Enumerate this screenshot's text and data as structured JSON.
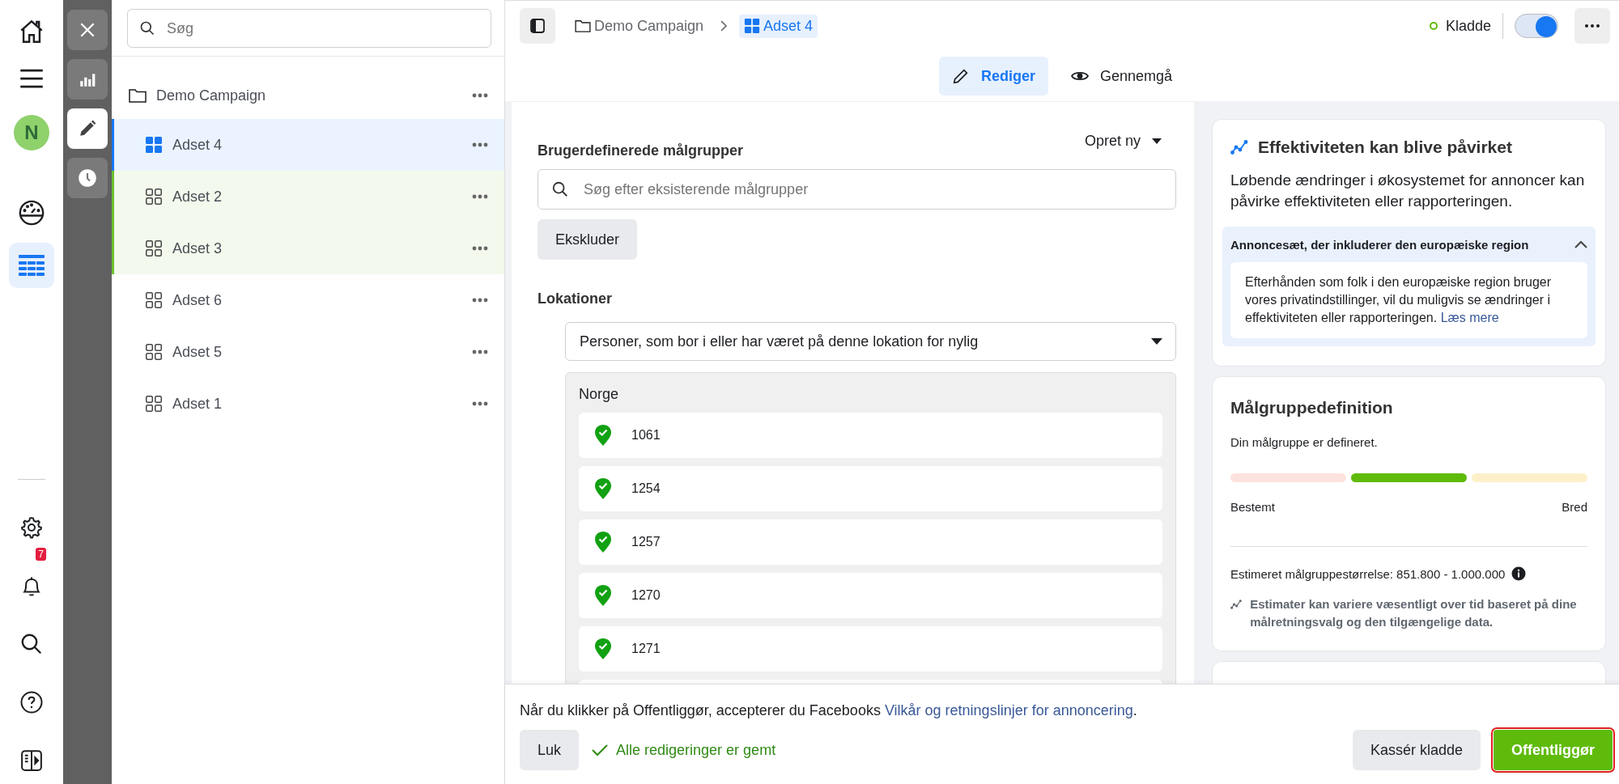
{
  "nav_rail": {
    "top": [
      {
        "kind": "home",
        "selected": false
      },
      {
        "kind": "menu",
        "selected": false
      },
      {
        "kind": "avatar",
        "label": "N",
        "selected": false
      },
      {
        "kind": "gauge",
        "selected": false
      },
      {
        "kind": "table",
        "selected": true
      }
    ],
    "bottom": [
      {
        "kind": "settings"
      },
      {
        "kind": "bell",
        "badge": "7"
      },
      {
        "kind": "search"
      },
      {
        "kind": "help"
      },
      {
        "kind": "panel"
      }
    ]
  },
  "tool_rail": [
    {
      "kind": "close",
      "selected": false
    },
    {
      "kind": "chart",
      "selected": false
    },
    {
      "kind": "edit",
      "selected": true
    },
    {
      "kind": "history",
      "selected": false
    }
  ],
  "tree": {
    "search": {
      "placeholder": "Søg"
    },
    "campaign": {
      "label": "Demo Campaign",
      "children": [
        {
          "label": "Adset 4",
          "selected": true,
          "highlighted": false
        },
        {
          "label": "Adset 2",
          "selected": false,
          "highlighted": true
        },
        {
          "label": "Adset 3",
          "selected": false,
          "highlighted": true
        },
        {
          "label": "Adset 6",
          "selected": false,
          "highlighted": false
        },
        {
          "label": "Adset 5",
          "selected": false,
          "highlighted": false
        },
        {
          "label": "Adset 1",
          "selected": false,
          "highlighted": false
        }
      ]
    }
  },
  "header": {
    "breadcrumbs": [
      {
        "kind": "folder",
        "label": "Demo Campaign",
        "selected": false
      },
      {
        "kind": "adset",
        "label": "Adset 4",
        "selected": true
      }
    ],
    "status": {
      "label": "Kladde"
    },
    "toggle": {
      "on": true
    }
  },
  "mode_tabs": [
    {
      "kind": "edit",
      "label": "Rediger",
      "selected": true
    },
    {
      "kind": "review",
      "label": "Gennemgå",
      "selected": false
    }
  ],
  "audiences": {
    "title": "Brugerdefinerede målgrupper",
    "create_menu": "Opret ny",
    "search": {
      "placeholder": "Søg efter eksisterende målgrupper"
    },
    "exclude_button": "Ekskluder"
  },
  "locations": {
    "title": "Lokationer",
    "dropdown": "Personer, som bor i eller har været på denne lokation for nylig",
    "country": "Norge",
    "items": [
      {
        "label": "1061"
      },
      {
        "label": "1254"
      },
      {
        "label": "1257"
      },
      {
        "label": "1270"
      },
      {
        "label": "1271"
      }
    ]
  },
  "notice_card": {
    "title": "Effektiviteten kan blive påvirket",
    "text": "Løbende ændringer i økosystemet for annoncer kan påvirke effektiviteten eller rapporteringen.",
    "accordion": {
      "title": "Annoncesæt, der inkluderer den europæiske region",
      "expanded": true,
      "text": "Efterhånden som folk i den europæiske region bruger vores privatindstillinger, vil du muligvis se ændringer i effektiviteten eller rapporteringen.",
      "link": "Læs mere"
    }
  },
  "definition_card": {
    "title": "Målgruppedefinition",
    "status": "Din målgruppe er defineret.",
    "meter": [
      {
        "color": "#fde3df"
      },
      {
        "color": "#5fbb0b"
      },
      {
        "color": "#fdf0c9"
      }
    ],
    "left_label": "Bestemt",
    "right_label": "Bred",
    "estimate": "Estimeret målgruppestørrelse: 851.800 - 1.000.000",
    "note": "Estimater kan variere væsentligt over tid baseret på dine målretningsvalg og den tilgængelige data."
  },
  "footer": {
    "terms_text": "Når du klikker på Offentliggør, accepterer du Facebooks",
    "terms_link": "Vilkår og retningslinjer for annoncering",
    "terms_end": ".",
    "close_button": "Luk",
    "saved_status": "Alle redigeringer er gemt",
    "discard_button": "Kassér kladde",
    "publish_button": "Offentliggør"
  }
}
